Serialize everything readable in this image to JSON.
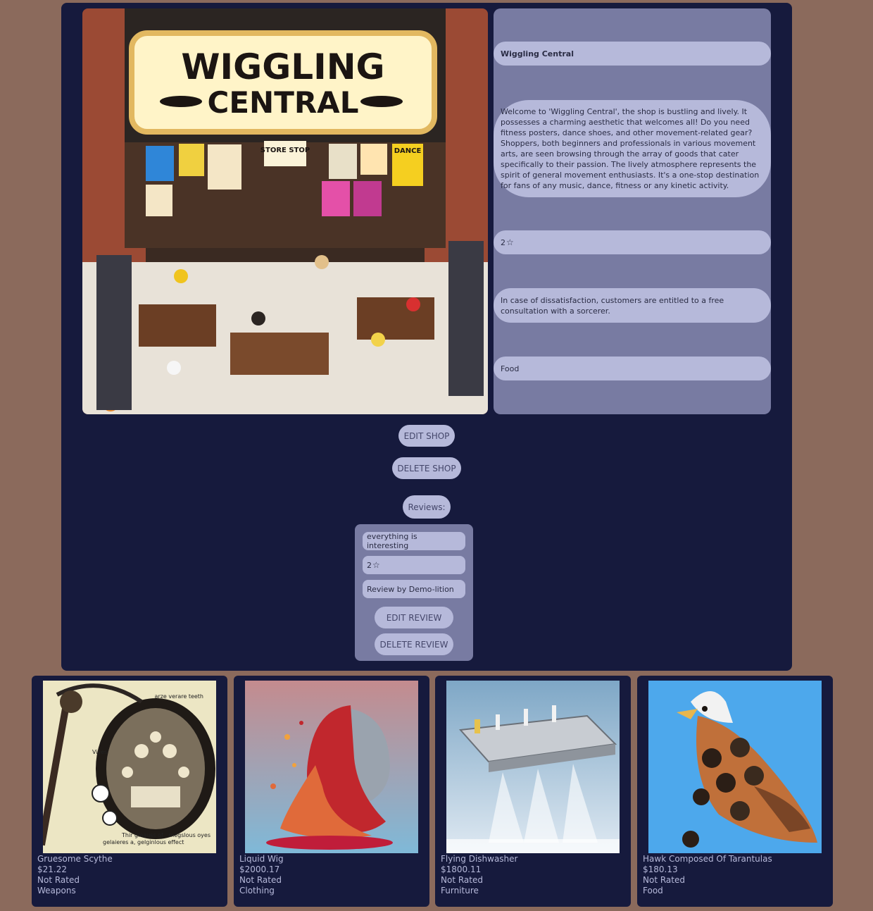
{
  "shop": {
    "name": "Wiggling Central",
    "description": "Welcome to 'Wiggling Central', the shop is bustling and lively. It possesses a charming aesthetic that welcomes all! Do you need fitness posters, dance shoes, and other movement-related gear? Shoppers, both beginners and professionals in various movement arts, are seen browsing through the array of goods that cater specifically to their passion. The lively atmosphere represents the spirit of general movement enthusiasts. It's a one-stop destination for fans of any music, dance, fitness or any kinetic activity.",
    "rating": "2",
    "policy": "In case of dissatisfaction, customers are entitled to a free consultation with a sorcerer.",
    "category": "Food",
    "image": {
      "sign_line1": "WIGGLING",
      "sign_line2": "CENTRAL",
      "store_sign": "STORE STOP",
      "dance_sign": "DANCE"
    }
  },
  "actions": {
    "edit_shop": "EDIT SHOP",
    "delete_shop": "DELETE SHOP",
    "reviews_label": "Reviews:"
  },
  "review": {
    "text": "everything is interesting",
    "rating": "2",
    "author": "Review by Demo-lition",
    "edit": "EDIT REVIEW",
    "delete": "DELETE REVIEW"
  },
  "products": [
    {
      "name": "Gruesome Scythe",
      "price": "$21.22",
      "rating": "Not Rated",
      "category": "Weapons",
      "image_text": {
        "top": "arze verare teeth",
        "left": "Viyes",
        "bottom1": "Thir gloauss of",
        "bottom2": "gelaieres a, gelginlous effect",
        "right": "megslous oyes"
      }
    },
    {
      "name": "Liquid Wig",
      "price": "$2000.17",
      "rating": "Not Rated",
      "category": "Clothing"
    },
    {
      "name": "Flying Dishwasher",
      "price": "$1800.11",
      "rating": "Not Rated",
      "category": "Furniture"
    },
    {
      "name": "Hawk Composed Of Tarantulas",
      "price": "$180.13",
      "rating": "Not Rated",
      "category": "Food"
    }
  ],
  "colors": {
    "page_bg": "#8b6a5c",
    "panel_bg": "#161a3d",
    "info_bg": "#787ba2",
    "pill_bg": "#b6b9da"
  }
}
